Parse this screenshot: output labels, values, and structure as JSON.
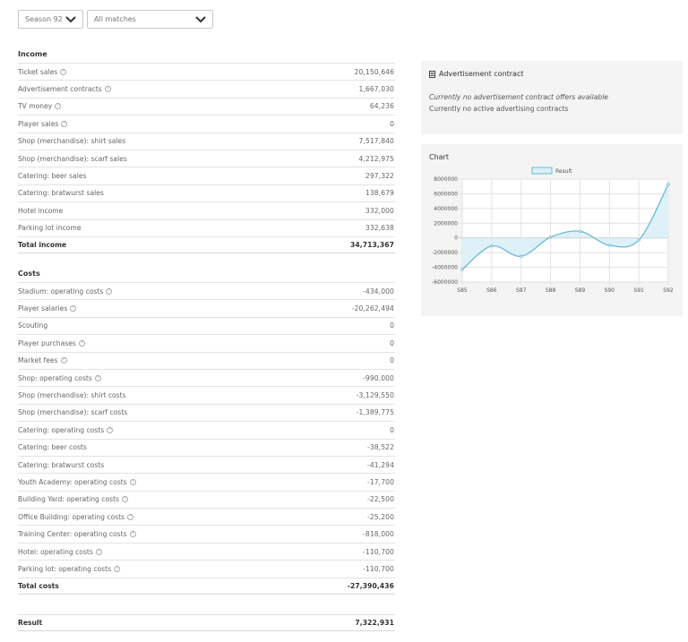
{
  "filters": {
    "season": "Season 92",
    "matches": "All matches"
  },
  "income": {
    "title": "Income",
    "rows": [
      {
        "label": "Ticket sales",
        "value": "20,150,646",
        "info": true
      },
      {
        "label": "Advertisement contracts",
        "value": "1,667,030",
        "info": true
      },
      {
        "label": "TV money",
        "value": "64,236",
        "info": true
      },
      {
        "label": "Player sales",
        "value": "0",
        "info": true
      },
      {
        "label": "Shop (merchandise): shirt sales",
        "value": "7,517,840",
        "info": false
      },
      {
        "label": "Shop (merchandise): scarf sales",
        "value": "4,212,975",
        "info": false
      },
      {
        "label": "Catering: beer sales",
        "value": "297,322",
        "info": false
      },
      {
        "label": "Catering: bratwurst sales",
        "value": "138,679",
        "info": false
      },
      {
        "label": "Hotel income",
        "value": "332,000",
        "info": false
      },
      {
        "label": "Parking lot income",
        "value": "332,638",
        "info": false
      }
    ],
    "total_label": "Total income",
    "total_value": "34,713,367"
  },
  "costs": {
    "title": "Costs",
    "rows": [
      {
        "label": "Stadium: operating costs",
        "value": "-434,000",
        "info": true
      },
      {
        "label": "Player salaries",
        "value": "-20,262,494",
        "info": true
      },
      {
        "label": "Scouting",
        "value": "0",
        "info": false
      },
      {
        "label": "Player purchases",
        "value": "0",
        "info": true
      },
      {
        "label": "Market fees",
        "value": "0",
        "info": true
      },
      {
        "label": "Shop: operating costs",
        "value": "-990,000",
        "info": true
      },
      {
        "label": "Shop (merchandise): shirt costs",
        "value": "-3,129,550",
        "info": false
      },
      {
        "label": "Shop (merchandise): scarf costs",
        "value": "-1,389,775",
        "info": false
      },
      {
        "label": "Catering: operating costs",
        "value": "0",
        "info": true
      },
      {
        "label": "Catering: beer costs",
        "value": "-38,522",
        "info": false
      },
      {
        "label": "Catering: bratwurst costs",
        "value": "-41,294",
        "info": false
      },
      {
        "label": "Youth Academy: operating costs",
        "value": "-17,700",
        "info": true
      },
      {
        "label": "Building Yard: operating costs",
        "value": "-22,500",
        "info": true
      },
      {
        "label": "Office Building: operating costs",
        "value": "-25,200",
        "info": true
      },
      {
        "label": "Training Center: operating costs",
        "value": "-818,000",
        "info": true
      },
      {
        "label": "Hotel: operating costs",
        "value": "-110,700",
        "info": true
      },
      {
        "label": "Parking lot: operating costs",
        "value": "-110,700",
        "info": true
      }
    ],
    "total_label": "Total costs",
    "total_value": "-27,390,436"
  },
  "result": {
    "label": "Result",
    "value": "7,322,931"
  },
  "advertisement": {
    "title": "Advertisement contract",
    "icon": "document-icon",
    "no_offers": "Currently no advertisement contract offers available",
    "no_active": "Currently no active advertising contracts"
  },
  "chart_panel": {
    "title": "Chart"
  },
  "chart_data": {
    "type": "line",
    "series": [
      {
        "name": "Result",
        "color": "#6bb8d6",
        "fill": "#dceff7",
        "values": [
          -4300000,
          -1100000,
          -2500000,
          100000,
          900000,
          -1000000,
          -300000,
          7300000
        ]
      }
    ],
    "categories": [
      "S85",
      "S86",
      "S87",
      "S88",
      "S89",
      "S90",
      "S91",
      "S92"
    ],
    "ylim": [
      -6000000,
      8000000
    ],
    "yticks": [
      8000000,
      6000000,
      4000000,
      2000000,
      0,
      -2000000,
      -4000000,
      -6000000
    ],
    "ytick_labels": [
      "8000000",
      "6000000",
      "4000000",
      "2000000",
      "0",
      "-2000000",
      "-4000000",
      "-6000000"
    ],
    "grid": true,
    "legend_position": "top-center"
  }
}
